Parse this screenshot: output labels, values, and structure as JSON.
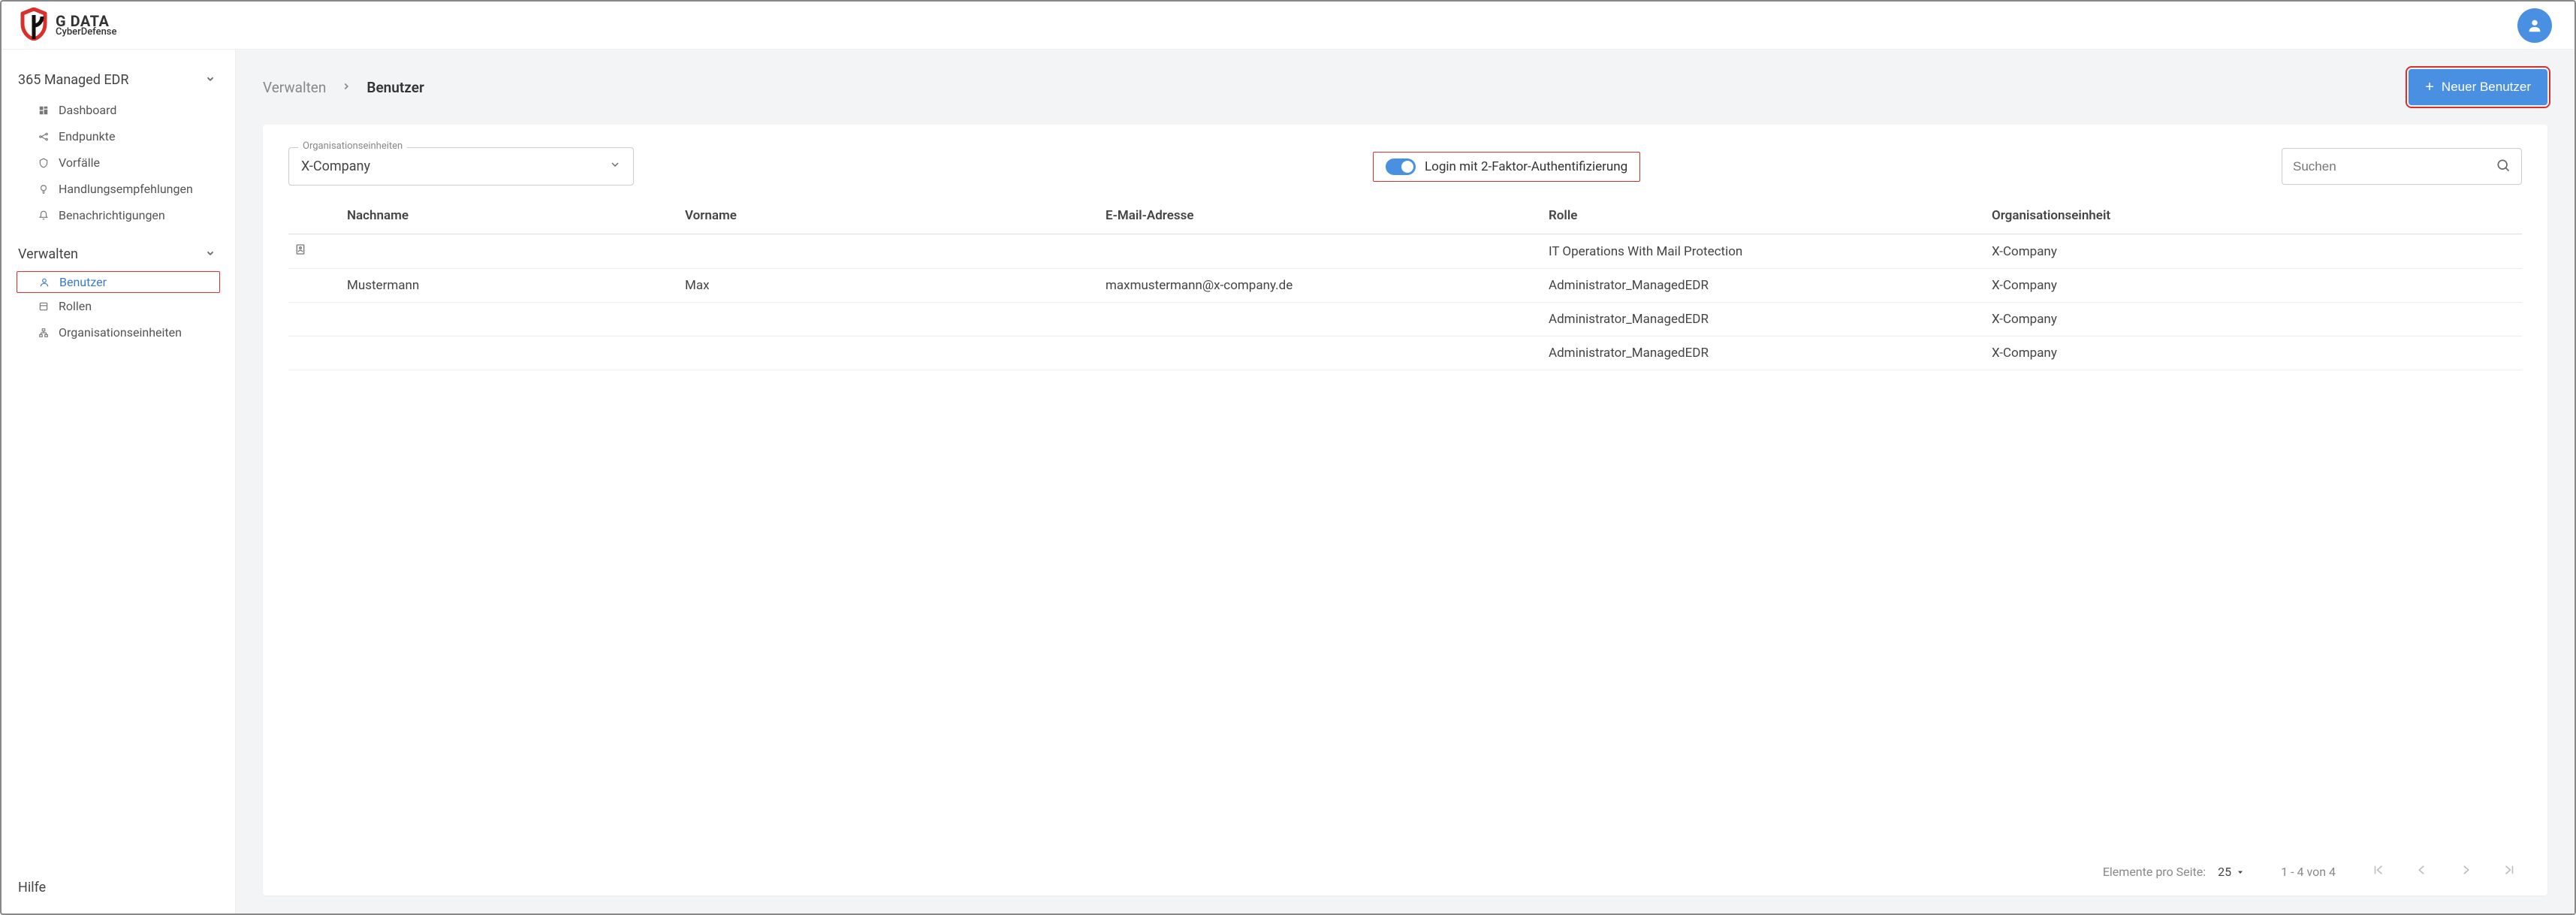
{
  "brand": {
    "line1": "G DATA",
    "line2": "CyberDefense"
  },
  "sidebar": {
    "section1": {
      "title": "365 Managed EDR"
    },
    "items1": [
      {
        "icon": "dashboard",
        "label": "Dashboard"
      },
      {
        "icon": "endpoints",
        "label": "Endpunkte"
      },
      {
        "icon": "incidents",
        "label": "Vorfälle"
      },
      {
        "icon": "recs",
        "label": "Handlungsempfehlungen"
      },
      {
        "icon": "bell",
        "label": "Benachrichtigungen"
      }
    ],
    "section2": {
      "title": "Verwalten"
    },
    "items2": [
      {
        "icon": "user",
        "label": "Benutzer",
        "active": true
      },
      {
        "icon": "roles",
        "label": "Rollen"
      },
      {
        "icon": "org",
        "label": "Organisationseinheiten"
      }
    ],
    "help": "Hilfe"
  },
  "breadcrumb": {
    "root": "Verwalten",
    "current": "Benutzer"
  },
  "actions": {
    "new_user": "Neuer Benutzer"
  },
  "filters": {
    "ou_label": "Organisationseinheiten",
    "ou_value": "X-Company",
    "twofa_label": "Login mit 2-Faktor-Authentifizierung",
    "search_placeholder": "Suchen"
  },
  "table": {
    "headers": {
      "lastname": "Nachname",
      "firstname": "Vorname",
      "email": "E-Mail-Adresse",
      "role": "Rolle",
      "org": "Organisationseinheit"
    },
    "rows": [
      {
        "icon": true,
        "lastname": "",
        "firstname": "",
        "email": "",
        "role": "IT Operations With Mail Protection",
        "org": "X-Company"
      },
      {
        "icon": false,
        "lastname": "Mustermann",
        "firstname": "Max",
        "email": "maxmustermann@x-company.de",
        "role": "Administrator_ManagedEDR",
        "org": "X-Company"
      },
      {
        "icon": false,
        "lastname": "",
        "firstname": "",
        "email": "",
        "role": "Administrator_ManagedEDR",
        "org": "X-Company"
      },
      {
        "icon": false,
        "lastname": "",
        "firstname": "",
        "email": "",
        "role": "Administrator_ManagedEDR",
        "org": "X-Company"
      }
    ]
  },
  "pagination": {
    "items_per_page_label": "Elemente pro Seite:",
    "items_per_page_value": "25",
    "range": "1 - 4 von 4"
  }
}
